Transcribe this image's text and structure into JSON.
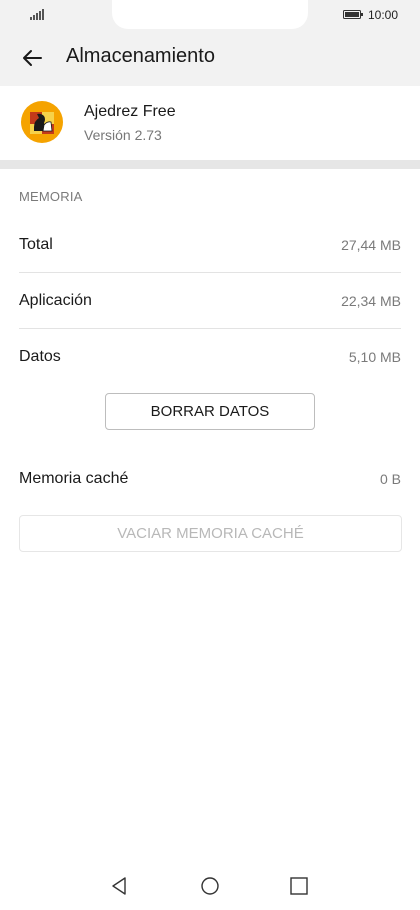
{
  "status_bar": {
    "time": "10:00",
    "signal_icon": "signal-icon",
    "battery_icon": "battery-icon"
  },
  "header": {
    "title": "Almacenamiento",
    "back_icon": "back-arrow-icon"
  },
  "app": {
    "name": "Ajedrez Free",
    "version": "Versión 2.73",
    "icon": "chess-app-icon"
  },
  "memory": {
    "section_label": "MEMORIA",
    "rows": [
      {
        "label": "Total",
        "value": "27,44 MB"
      },
      {
        "label": "Aplicación",
        "value": "22,34 MB"
      },
      {
        "label": "Datos",
        "value": "5,10 MB"
      }
    ],
    "clear_data_label": "BORRAR DATOS",
    "cache": {
      "label": "Memoria caché",
      "value": "0 B"
    },
    "clear_cache_label": "VACIAR MEMORIA CACHÉ"
  },
  "nav_bar": {
    "back_icon": "nav-back-icon",
    "home_icon": "nav-home-icon",
    "recents_icon": "nav-recents-icon"
  },
  "colors": {
    "background": "#ffffff",
    "header_background": "#f2f2f2",
    "secondary_text": "#7a7a7a",
    "disabled_text": "#b8b8b8"
  }
}
